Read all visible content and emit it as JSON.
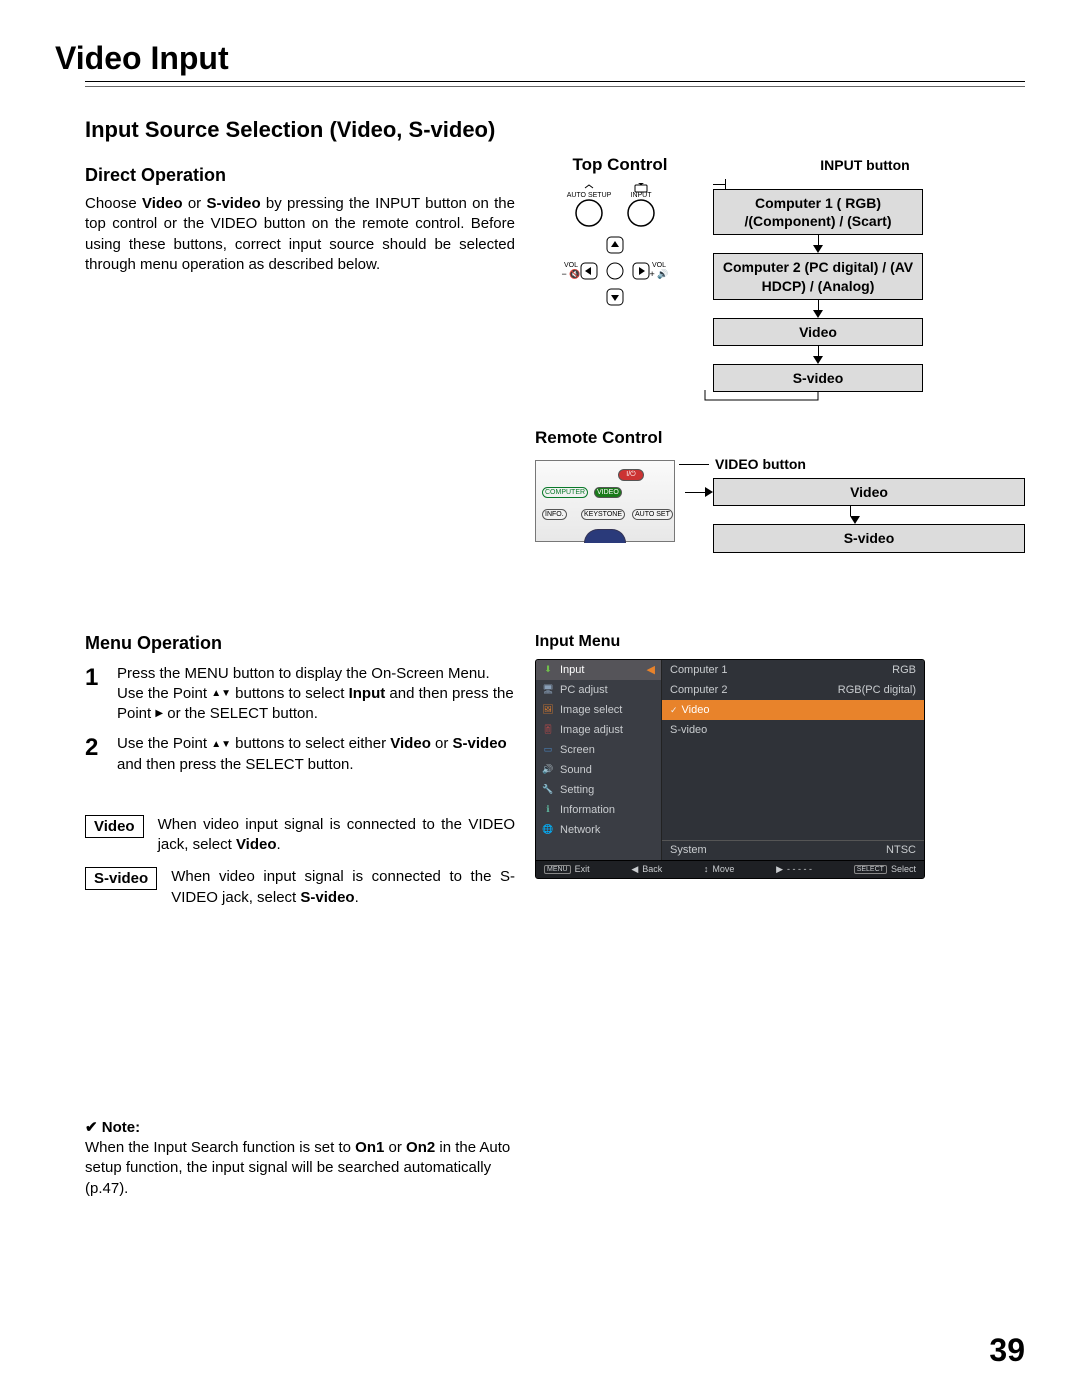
{
  "page_title": "Video Input",
  "page_number": "39",
  "section_title": "Input Source Selection (Video, S-video)",
  "direct_op": {
    "heading": "Direct Operation",
    "body_pre": "Choose ",
    "body_b1": "Video",
    "body_mid1": " or ",
    "body_b2": "S-video",
    "body_post": " by pressing the INPUT button on the top control or the VIDEO  button on the remote control. Before using these buttons, correct input source should be selected through menu operation as described below."
  },
  "top_control": {
    "label": "Top Control",
    "input_btn_label": "INPUT button",
    "auto_setup": "AUTO SETUP",
    "input": "INPUT",
    "vol_minus": "VOL\n−",
    "vol_plus": "VOL\n+"
  },
  "flow": {
    "box1": "Computer 1 ( RGB) /(Component) / (Scart)",
    "box2": "Computer 2 (PC digital) / (AV HDCP) / (Analog)",
    "box3": "Video",
    "box4": "S-video"
  },
  "remote": {
    "heading": "Remote Control",
    "video_btn_label": "VIDEO button",
    "buttons": {
      "computer": "COMPUTER",
      "video": "VIDEO",
      "info": "INFO.",
      "keystone": "KEYSTONE",
      "autoset": "AUTO SET"
    },
    "flow_video": "Video",
    "flow_svideo": "S-video"
  },
  "menu_op": {
    "heading": "Menu Operation",
    "step1_a": "Press the MENU button to display the On-Screen Menu. Use the Point ",
    "step1_b": " buttons to select ",
    "step1_bold": "Input",
    "step1_c": " and then press the Point ",
    "step1_d": " or the SELECT button.",
    "step2_a": "Use the Point ",
    "step2_b": " buttons to select either ",
    "step2_bold1": "Video",
    "step2_c": " or ",
    "step2_bold2": "S-video",
    "step2_d": " and then press the SELECT button.",
    "video_label": "Video",
    "video_def_a": "When video input signal is connected to the VIDEO jack, select ",
    "video_def_bold": "Video",
    "video_def_b": ".",
    "svideo_label": "S-video",
    "svideo_def_a": "When video input signal is connected to the S-VIDEO jack, select ",
    "svideo_def_bold": "S-video",
    "svideo_def_b": "."
  },
  "input_menu": {
    "heading": "Input Menu",
    "side_items": [
      "Input",
      "PC adjust",
      "Image select",
      "Image adjust",
      "Screen",
      "Sound",
      "Setting",
      "Information",
      "Network"
    ],
    "main_items": [
      {
        "label": "Computer 1",
        "right": "RGB"
      },
      {
        "label": "Computer 2",
        "right": "RGB(PC digital)"
      },
      {
        "label": "Video",
        "right": "",
        "selected": true
      },
      {
        "label": "S-video",
        "right": ""
      }
    ],
    "system_label": "System",
    "system_value": "NTSC",
    "footer": {
      "exit_key": "MENU",
      "exit": "Exit",
      "back_sym": "◀",
      "back": "Back",
      "move_sym": "↕",
      "move": "Move",
      "dash": "- - - - -",
      "select_key": "SELECT",
      "select": "Select"
    }
  },
  "note": {
    "lead": "✔ Note:",
    "body_a": "When the Input Search function is set to ",
    "body_b1": "On1",
    "body_mid": " or ",
    "body_b2": "On2",
    "body_b": " in the Auto setup function, the input signal will be searched automatically (p.47)."
  }
}
